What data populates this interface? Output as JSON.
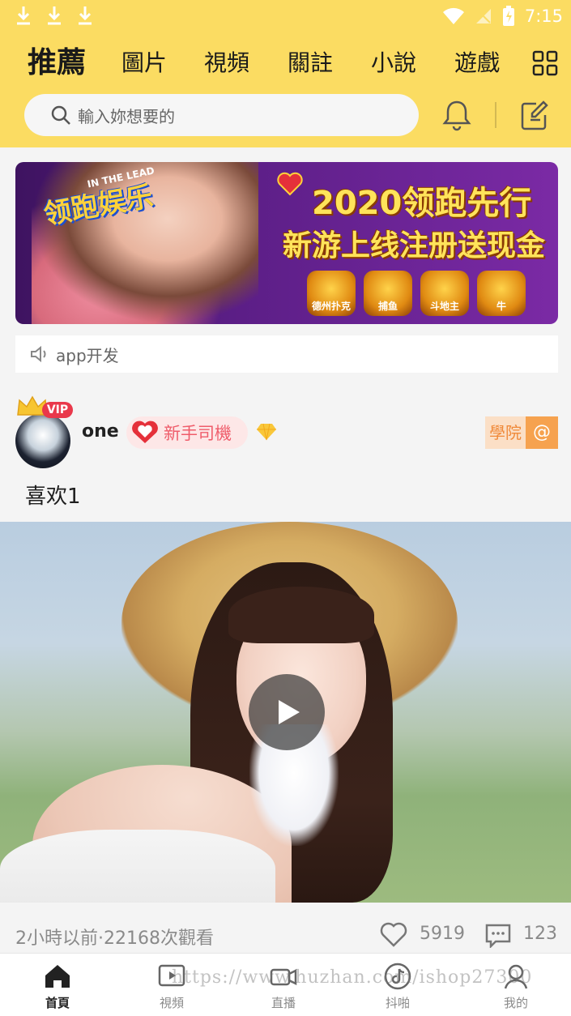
{
  "status_bar": {
    "time": "7:15",
    "icons": [
      "download-icon",
      "download-icon",
      "download-icon",
      "wifi-icon",
      "no-signal-icon",
      "battery-icon"
    ]
  },
  "tabs": [
    {
      "label": "推薦",
      "active": true
    },
    {
      "label": "圖片",
      "active": false
    },
    {
      "label": "視頻",
      "active": false
    },
    {
      "label": "關註",
      "active": false
    },
    {
      "label": "小說",
      "active": false
    },
    {
      "label": "遊戲",
      "active": false
    }
  ],
  "search": {
    "placeholder": "輸入妳想要的"
  },
  "banner": {
    "logo_text": "领跑娱乐",
    "logo_small": "IN THE LEAD",
    "line1": "2020领跑先行",
    "line2": "新游上线注册送现金",
    "games": [
      "德州扑克",
      "捕鱼",
      "斗地主",
      "牛"
    ]
  },
  "notice": {
    "text": "app开发"
  },
  "post": {
    "vip_badge": "VIP",
    "username": "one",
    "rank": "新手司機",
    "school_label": "學院",
    "at_label": "@",
    "caption": "喜欢1",
    "meta": "2小時以前·22168次觀看",
    "likes": "5919",
    "comments": "123"
  },
  "bottom_nav": [
    {
      "label": "首頁",
      "icon": "home-icon",
      "active": true
    },
    {
      "label": "視頻",
      "icon": "video-icon",
      "active": false
    },
    {
      "label": "直播",
      "icon": "live-camera-icon",
      "active": false
    },
    {
      "label": "抖啪",
      "icon": "music-note-icon",
      "active": false
    },
    {
      "label": "我的",
      "icon": "profile-icon",
      "active": false
    }
  ],
  "watermark": "https://www.huzhan.com/ishop27300",
  "colors": {
    "header_bg": "#fbdc62",
    "accent_orange": "#f6a24f",
    "rank_pink": "#ef5d6b"
  }
}
